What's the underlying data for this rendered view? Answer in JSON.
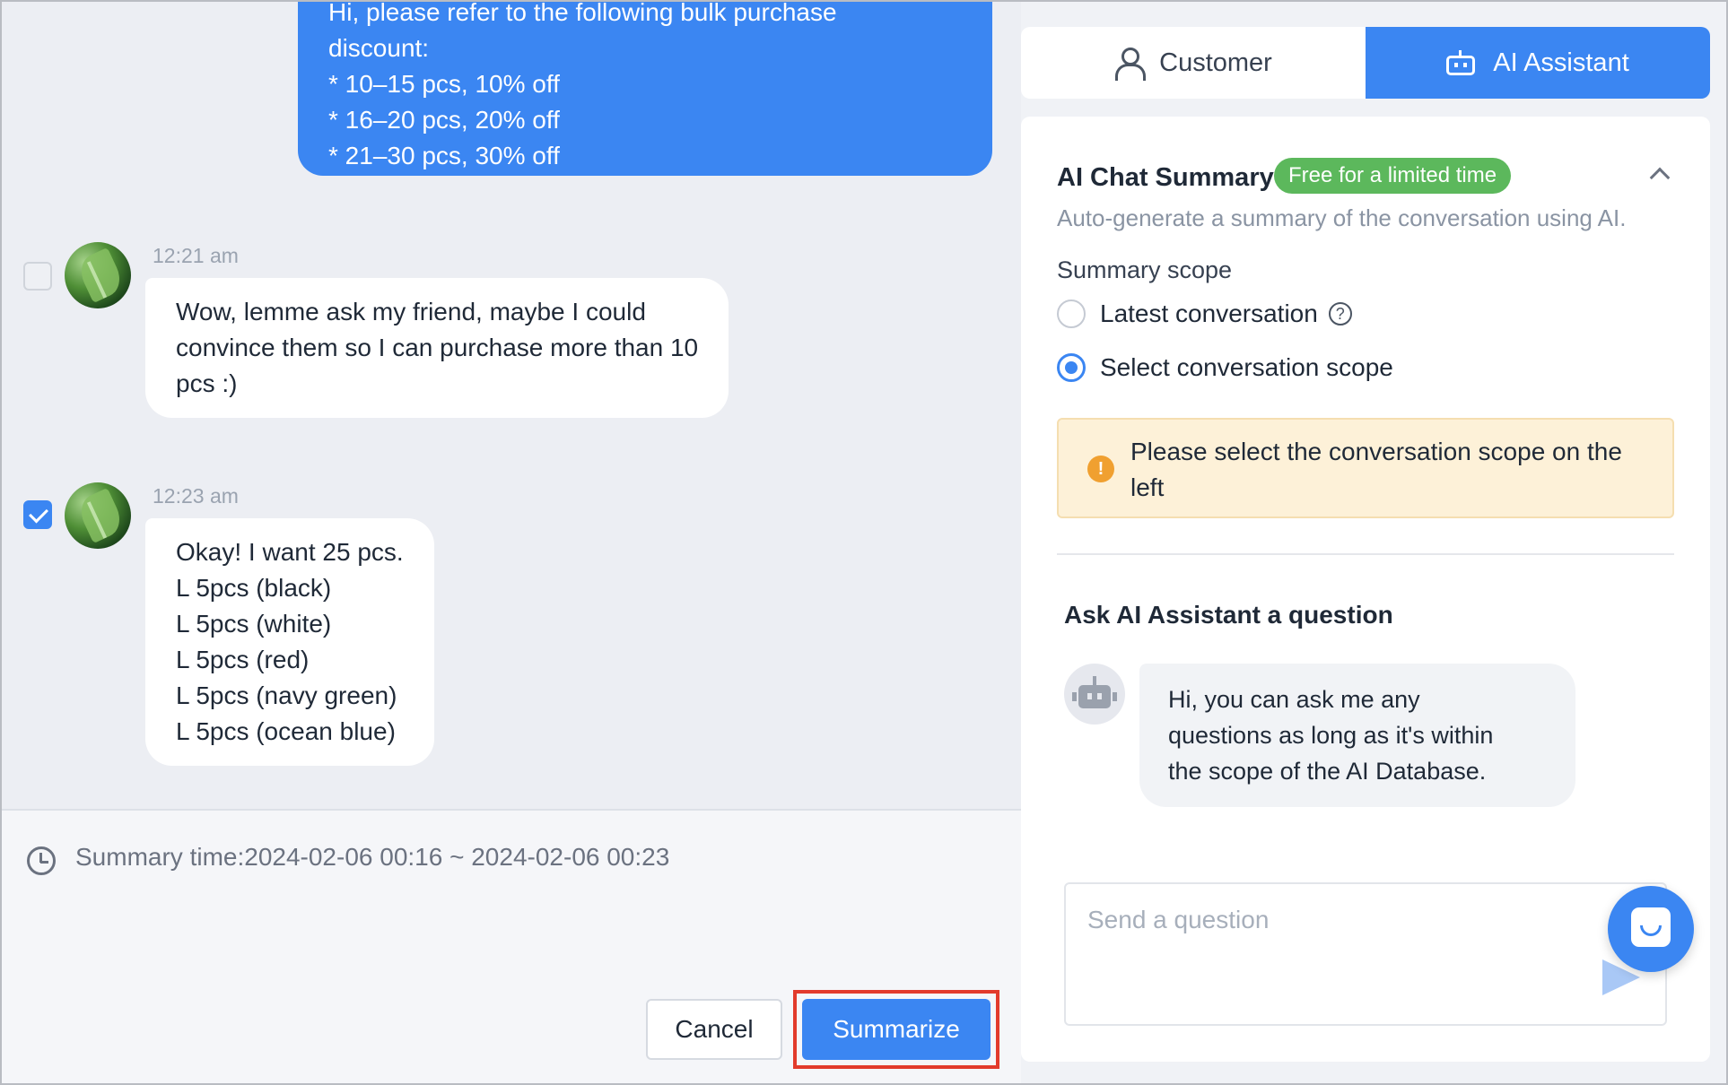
{
  "chat": {
    "outgoing_lines": [
      "Hi, please refer to the following bulk purchase",
      "discount:",
      "* 10–15 pcs, 10% off",
      "* 16–20 pcs, 20% off",
      "* 21–30 pcs, 30% off"
    ],
    "messages": [
      {
        "time": "12:21 am",
        "checked": false,
        "lines": [
          "Wow, lemme ask my friend, maybe I could",
          "convince them so I can purchase more than 10",
          "pcs :)"
        ]
      },
      {
        "time": "12:23 am",
        "checked": true,
        "lines": [
          "Okay! I want 25 pcs.",
          "L 5pcs (black)",
          "L 5pcs (white)",
          "L 5pcs (red)",
          "L 5pcs (navy green)",
          "L 5pcs (ocean blue)"
        ]
      }
    ]
  },
  "footer": {
    "summary_time": "Summary time:2024-02-06 00:16 ~ 2024-02-06 00:23",
    "cancel_label": "Cancel",
    "summarize_label": "Summarize"
  },
  "tabs": {
    "customer": "Customer",
    "ai_assistant": "AI Assistant",
    "active": "ai_assistant"
  },
  "summary_panel": {
    "title": "AI Chat Summary",
    "badge": "Free for a limited time",
    "description": "Auto-generate a summary of the conversation using AI.",
    "scope_label": "Summary scope",
    "option_latest": "Latest conversation",
    "option_select": "Select conversation scope",
    "selected_option": "select",
    "warning": "Please select the conversation scope on the left"
  },
  "assistant": {
    "title": "Ask AI Assistant a question",
    "greeting_lines": [
      "Hi, you can ask me any",
      "questions as long as it's within",
      "the scope of the AI Database."
    ],
    "input_placeholder": "Send a question"
  },
  "colors": {
    "primary": "#3b86f2",
    "badge_green": "#5cb85c",
    "warning_bg": "#fdf1d8",
    "highlight_red": "#e23b2c"
  },
  "icons": {
    "clock": "clock-icon",
    "customer_tab": "person-icon",
    "ai_tab": "robot-icon",
    "collapse": "chevron-up-icon",
    "help": "question-circle-icon",
    "warning": "exclamation-circle-icon",
    "send": "send-arrow-icon",
    "launcher": "chat-launcher-icon"
  }
}
